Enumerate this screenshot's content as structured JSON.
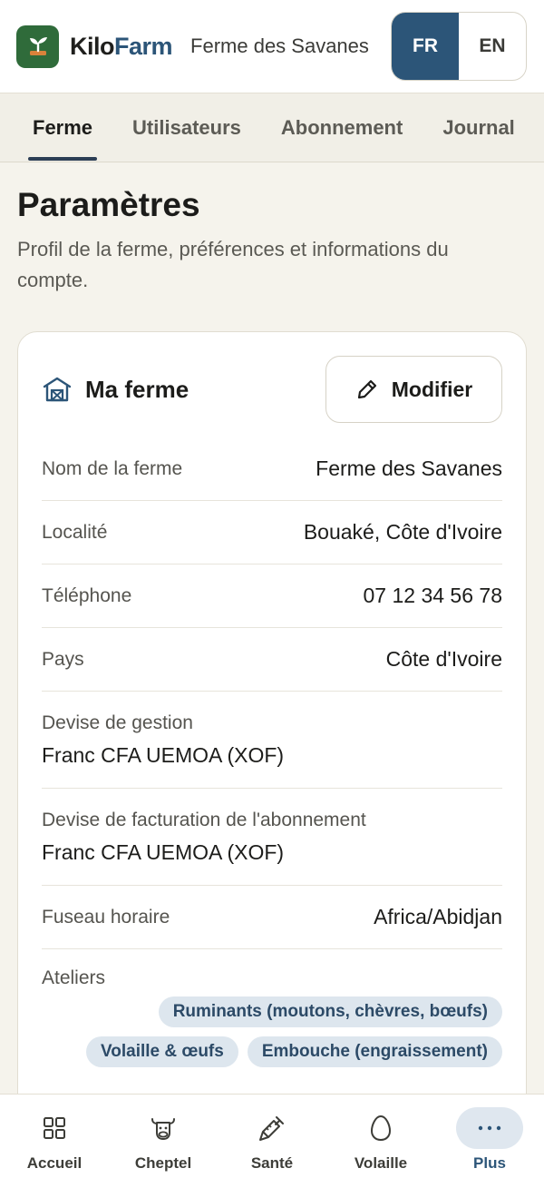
{
  "header": {
    "brand_part1": "Kilo",
    "brand_part2": "Farm",
    "farm_name": "Ferme des Savanes",
    "languages": [
      {
        "label": "FR",
        "active": true
      },
      {
        "label": "EN",
        "active": false
      }
    ]
  },
  "tabs": [
    {
      "label": "Ferme",
      "active": true
    },
    {
      "label": "Utilisateurs",
      "active": false
    },
    {
      "label": "Abonnement",
      "active": false
    },
    {
      "label": "Journal",
      "active": false
    }
  ],
  "page": {
    "title": "Paramètres",
    "subtitle": "Profil de la ferme, préférences et informations du compte."
  },
  "card": {
    "title": "Ma ferme",
    "icon": "barn-icon",
    "edit_label": "Modifier",
    "fields": [
      {
        "label": "Nom de la ferme",
        "value": "Ferme des Savanes"
      },
      {
        "label": "Localité",
        "value": "Bouaké, Côte d'Ivoire"
      },
      {
        "label": "Téléphone",
        "value": "07 12 34 56 78"
      },
      {
        "label": "Pays",
        "value": "Côte d'Ivoire"
      },
      {
        "label": "Devise de gestion",
        "value": "Franc CFA UEMOA (XOF)"
      },
      {
        "label": "Devise de facturation de l'abonnement",
        "value": "Franc CFA UEMOA (XOF)"
      },
      {
        "label": "Fuseau horaire",
        "value": "Africa/Abidjan"
      }
    ],
    "ateliers_label": "Ateliers",
    "ateliers": [
      "Ruminants (moutons, chèvres, bœufs)",
      "Volaille & œufs",
      "Embouche (engraissement)"
    ]
  },
  "bottom_nav": [
    {
      "label": "Accueil",
      "icon": "grid-icon",
      "active": false
    },
    {
      "label": "Cheptel",
      "icon": "cow-icon",
      "active": false
    },
    {
      "label": "Santé",
      "icon": "syringe-icon",
      "active": false
    },
    {
      "label": "Volaille",
      "icon": "egg-icon",
      "active": false
    },
    {
      "label": "Plus",
      "icon": "more-icon",
      "active": true
    }
  ],
  "colors": {
    "primary": "#2c5578",
    "logo_bg": "#2f6b3a",
    "page_bg": "#f5f3ec",
    "chip_bg": "#dde6ee"
  }
}
